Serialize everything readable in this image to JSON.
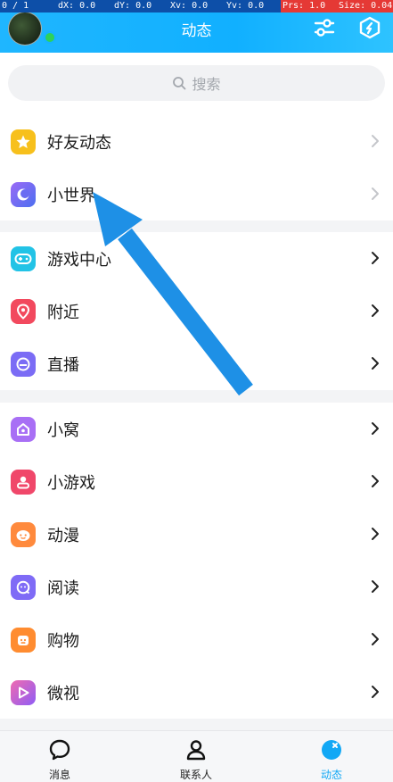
{
  "debug": {
    "cells": [
      "0 / 1",
      "dX: 0.0",
      "dY: 0.0",
      "Xv: 0.0",
      "Yv: 0.0",
      "Prs: 1.0",
      "Size: 0.04"
    ]
  },
  "header": {
    "title": "动态"
  },
  "search": {
    "placeholder": "搜索"
  },
  "groups": [
    {
      "items": [
        {
          "label": "好友动态",
          "icon": "star-icon",
          "color": "#f7c01c"
        },
        {
          "label": "小世界",
          "icon": "moon-icon",
          "color": "#5d6cf0"
        }
      ]
    },
    {
      "items": [
        {
          "label": "游戏中心",
          "icon": "gamepad-icon",
          "color": "#22c3e6"
        },
        {
          "label": "附近",
          "icon": "location-icon",
          "color": "#f2495e"
        },
        {
          "label": "直播",
          "icon": "live-icon",
          "color": "#7b6cf5"
        }
      ]
    },
    {
      "items": [
        {
          "label": "小窝",
          "icon": "home-icon",
          "color": "#a86ff5"
        },
        {
          "label": "小游戏",
          "icon": "joystick-icon",
          "color": "#f0476a"
        },
        {
          "label": "动漫",
          "icon": "cartoon-face-icon",
          "color": "#ff8a3d"
        },
        {
          "label": "阅读",
          "icon": "reading-icon",
          "color": "#7f6bf6"
        },
        {
          "label": "购物",
          "icon": "shopping-icon",
          "color": "#ff8c30"
        },
        {
          "label": "微视",
          "icon": "video-play-icon",
          "color": "#a867f2"
        }
      ]
    }
  ],
  "bottom_nav": [
    {
      "label": "消息",
      "icon": "chat-bubble-icon",
      "active": false
    },
    {
      "label": "联系人",
      "icon": "person-icon",
      "active": false
    },
    {
      "label": "动态",
      "icon": "dynamic-star-icon",
      "active": true
    }
  ],
  "colors": {
    "accent": "#12a8f5",
    "arrow": "#1e90e6"
  }
}
